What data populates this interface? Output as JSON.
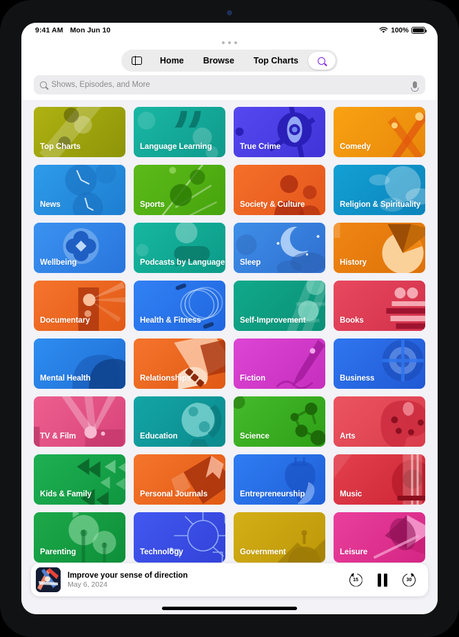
{
  "status_bar": {
    "time": "9:41 AM",
    "date": "Mon Jun 10",
    "battery_percent": "100%",
    "wifi_icon": "wifi-icon",
    "battery_icon": "battery-full-icon"
  },
  "nav": {
    "sidebar_icon": "sidebar-toggle-icon",
    "tabs": [
      {
        "label": "Home"
      },
      {
        "label": "Browse"
      },
      {
        "label": "Top Charts"
      }
    ],
    "search_icon": "search-icon",
    "search_accent": "#7d20e0"
  },
  "search": {
    "placeholder": "Shows, Episodes, and More",
    "value": "",
    "icon": "search-icon",
    "mic_icon": "microphone-icon"
  },
  "categories": [
    {
      "label": "Top Charts",
      "c1": "#aeb211",
      "c2": "#8d9408",
      "art": "topcharts"
    },
    {
      "label": "Language Learning",
      "c1": "#19b7a4",
      "c2": "#0f9a8c",
      "art": "quotes"
    },
    {
      "label": "True Crime",
      "c1": "#5548f0",
      "c2": "#4034d8",
      "art": "eye"
    },
    {
      "label": "Comedy",
      "c1": "#f9a213",
      "c2": "#e8880a",
      "art": "rays"
    },
    {
      "label": "News",
      "c1": "#2e9bea",
      "c2": "#1e7ed0",
      "art": "clocks"
    },
    {
      "label": "Sports",
      "c1": "#5cbb19",
      "c2": "#46a40d",
      "art": "leaf"
    },
    {
      "label": "Society & Culture",
      "c1": "#f5702a",
      "c2": "#e4561b",
      "art": "people"
    },
    {
      "label": "Religion & Spirituality",
      "c1": "#13a0d4",
      "c2": "#0b84bb",
      "art": "clouds"
    },
    {
      "label": "Wellbeing",
      "c1": "#3b92f0",
      "c2": "#2875dd",
      "art": "flower"
    },
    {
      "label": "Podcasts by Language",
      "c1": "#17b79f",
      "c2": "#0c9b88",
      "art": "bubbles"
    },
    {
      "label": "Sleep",
      "c1": "#3e8fe8",
      "c2": "#2f6fd0",
      "art": "moon"
    },
    {
      "label": "History",
      "c1": "#f08613",
      "c2": "#dd7208",
      "art": "pie"
    },
    {
      "label": "Documentary",
      "c1": "#f5742c",
      "c2": "#e25a16",
      "art": "camera"
    },
    {
      "label": "Health & Fitness",
      "c1": "#3281f5",
      "c2": "#1f66df",
      "art": "rope"
    },
    {
      "label": "Self-Improvement",
      "c1": "#11a98b",
      "c2": "#0a8f75",
      "art": "ladder"
    },
    {
      "label": "Books",
      "c1": "#e8495f",
      "c2": "#d2304a",
      "art": "books"
    },
    {
      "label": "Mental Health",
      "c1": "#2e8df0",
      "c2": "#1f6fd6",
      "art": "head"
    },
    {
      "label": "Relationships",
      "c1": "#f5742c",
      "c2": "#e05a14",
      "art": "hands"
    },
    {
      "label": "Fiction",
      "c1": "#dd45d5",
      "c2": "#c62fbd",
      "art": "pen"
    },
    {
      "label": "Business",
      "c1": "#2f76ef",
      "c2": "#2059d4",
      "art": "target"
    },
    {
      "label": "TV & Film",
      "c1": "#ec5f8e",
      "c2": "#d9437a",
      "art": "projector"
    },
    {
      "label": "Education",
      "c1": "#14a5a5",
      "c2": "#0a8a8d",
      "art": "globe"
    },
    {
      "label": "Science",
      "c1": "#45ba2c",
      "c2": "#2ea017",
      "art": "molecule"
    },
    {
      "label": "Arts",
      "c1": "#ec5460",
      "c2": "#d93c4c",
      "art": "palette"
    },
    {
      "label": "Kids & Family",
      "c1": "#1fb052",
      "c2": "#0f9640",
      "art": "kites"
    },
    {
      "label": "Personal Journals",
      "c1": "#f5752c",
      "c2": "#e25a14",
      "art": "journal"
    },
    {
      "label": "Entrepreneurship",
      "c1": "#2f7cf2",
      "c2": "#1f60d8",
      "art": "bulb"
    },
    {
      "label": "Music",
      "c1": "#e33f4c",
      "c2": "#cd2636",
      "art": "guitar"
    },
    {
      "label": "Parenting",
      "c1": "#1da94a",
      "c2": "#0d8f39",
      "art": "trees"
    },
    {
      "label": "Technology",
      "c1": "#4158f0",
      "c2": "#3242d8",
      "art": "circuit"
    },
    {
      "label": "Government",
      "c1": "#d4af16",
      "c2": "#bd9708",
      "art": "capitol"
    },
    {
      "label": "Leisure",
      "c1": "#ea3f9c",
      "c2": "#d42684",
      "art": "umbrella"
    }
  ],
  "now_playing": {
    "title": "Improve your sense of direction",
    "date": "May 6, 2024",
    "artwork_icon": "podcast-artwork",
    "skip_back_label": "15",
    "skip_back_icon": "skip-back-15-icon",
    "play_pause_icon": "pause-icon",
    "skip_forward_label": "30",
    "skip_forward_icon": "skip-forward-30-icon"
  },
  "home_indicator": "home-indicator"
}
